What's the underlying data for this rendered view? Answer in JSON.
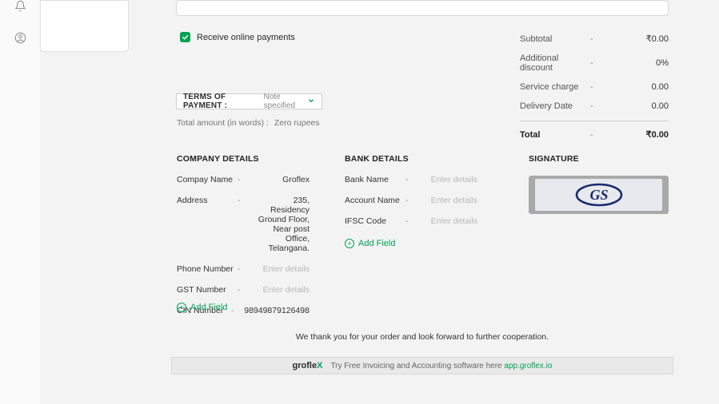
{
  "receive_payments_label": "Receive online payments",
  "totals": {
    "subtotal_label": "Subtotal",
    "subtotal_dash": "-",
    "subtotal_value": "₹0.00",
    "additional_discount_label": "Additional discount",
    "additional_discount_dash": "-",
    "additional_discount_value": "0%",
    "service_charge_label": "Service charge",
    "service_charge_dash": "-",
    "service_charge_value": "0.00",
    "delivery_date_label": "Delivery Date",
    "delivery_date_dash": "-",
    "delivery_date_value": "0.00",
    "total_label": "Total",
    "total_dash": "-",
    "total_value": "₹0.00"
  },
  "terms": {
    "label": "TERMS OF PAYMENT :",
    "value": "Note specified"
  },
  "amount_words": {
    "label": "Total amount (in words) :",
    "value": "Zero rupees"
  },
  "company": {
    "heading": "COMPANY DETAILS",
    "name_label": "Compay Name",
    "name_value": "Groflex",
    "address_label": "Address",
    "address_value": "235, Residency Ground Floor, Near post Office, Telangana.",
    "phone_label": "Phone Number",
    "phone_placeholder": "Enter details",
    "gst_label": "GST Number",
    "gst_placeholder": "Enter details",
    "cin_label": "CIN Number",
    "cin_value": "98949879126498",
    "add_field": "Add Field"
  },
  "bank": {
    "heading": "BANK DETAILS",
    "bank_name_label": "Bank Name",
    "bank_name_placeholder": "Enter details",
    "account_name_label": "Account Name",
    "account_name_placeholder": "Enter details",
    "ifsc_label": "IFSC Code",
    "ifsc_placeholder": "Enter details",
    "add_field": "Add Field"
  },
  "signature": {
    "heading": "SIGNATURE"
  },
  "thanks": "We thank you for your order and look forward to further cooperation.",
  "footer": {
    "logo_part1": "grofle",
    "logo_part2": "X",
    "msg": "Try Free Invoicing and Accounting software here",
    "link": "app.groflex.io"
  }
}
